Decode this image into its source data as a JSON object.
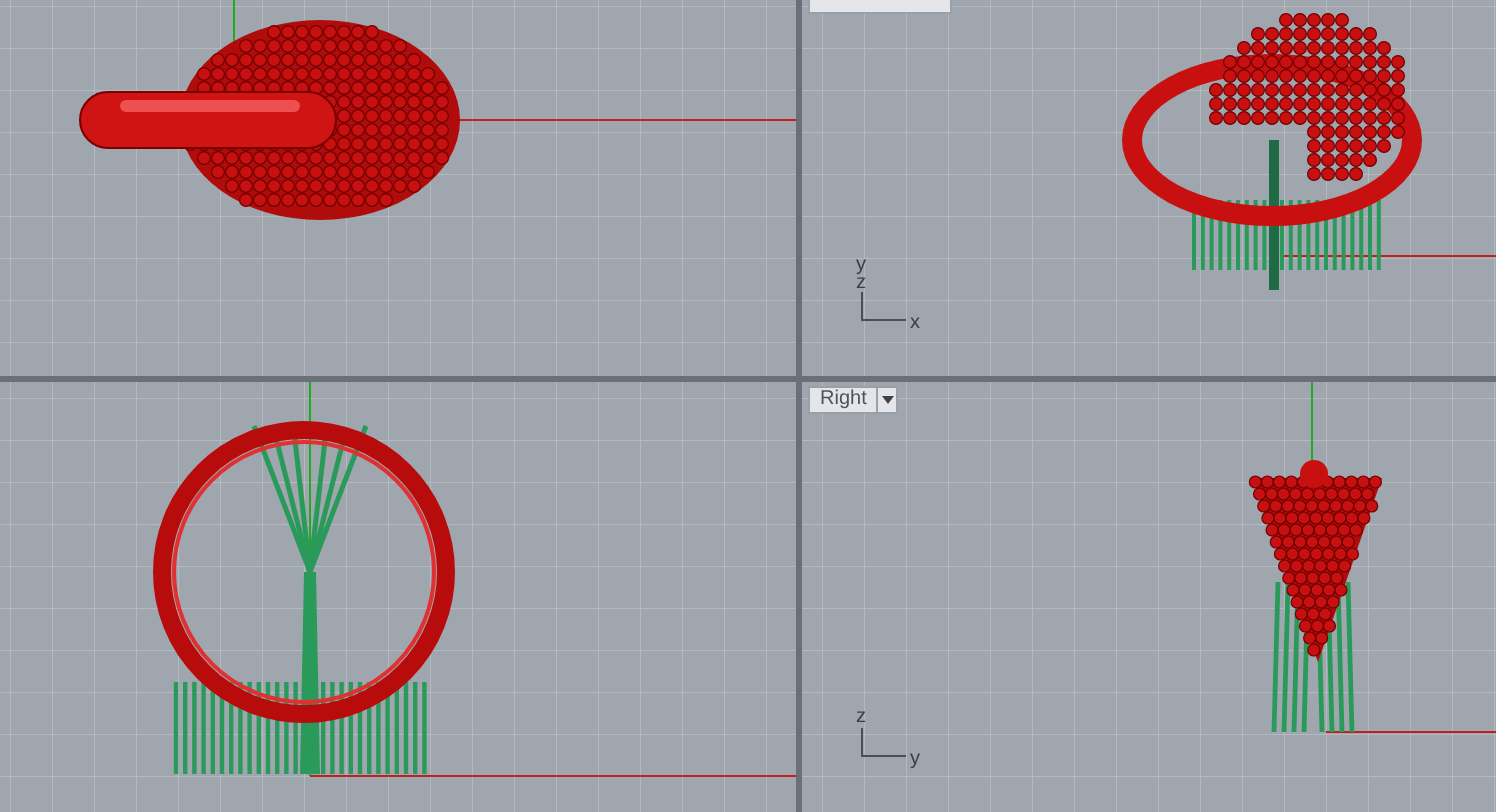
{
  "viewports": [
    {
      "kind": "top"
    },
    {
      "kind": "perspective",
      "tab": {
        "kind": "cut"
      },
      "axis_labels": [
        "y",
        "z",
        "x"
      ]
    },
    {
      "kind": "front"
    },
    {
      "kind": "right",
      "tab": {
        "kind": "full",
        "label": "Right"
      },
      "axis_labels": [
        "z",
        "y"
      ]
    }
  ]
}
